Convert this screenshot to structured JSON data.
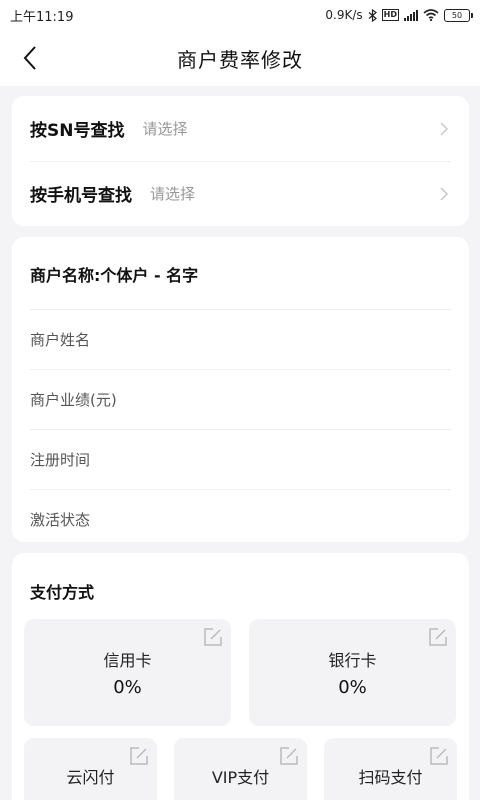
{
  "status_bar": {
    "time": "上午11:19",
    "net_speed": "0.9K/s",
    "volte": "HD",
    "battery": "50"
  },
  "nav": {
    "title": "商户费率修改"
  },
  "search": {
    "rows": [
      {
        "label": "按SN号查找",
        "placeholder": "请选择"
      },
      {
        "label": "按手机号查找",
        "placeholder": "请选择"
      }
    ]
  },
  "merchant": {
    "title": "商户名称:个体户 - 名字",
    "fields": [
      "商户姓名",
      "商户业绩(元)",
      "注册时间",
      "激活状态"
    ]
  },
  "payment": {
    "title": "支付方式",
    "methods": [
      {
        "name": "信用卡",
        "rate": "0%"
      },
      {
        "name": "银行卡",
        "rate": "0%"
      },
      {
        "name": "云闪付"
      },
      {
        "name": "VIP支付"
      },
      {
        "name": "扫码支付"
      }
    ]
  },
  "icons": {
    "back": "back-arrow-icon",
    "chevron": "chevron-right-icon",
    "edit": "edit-icon",
    "wifi": "wifi-icon",
    "signal": "signal-icon",
    "bluetooth": "bluetooth-icon",
    "battery": "battery-icon"
  },
  "colors": {
    "background": "#f4f4f6",
    "card": "#ffffff",
    "tile": "#f3f3f6",
    "placeholder": "#999999"
  }
}
